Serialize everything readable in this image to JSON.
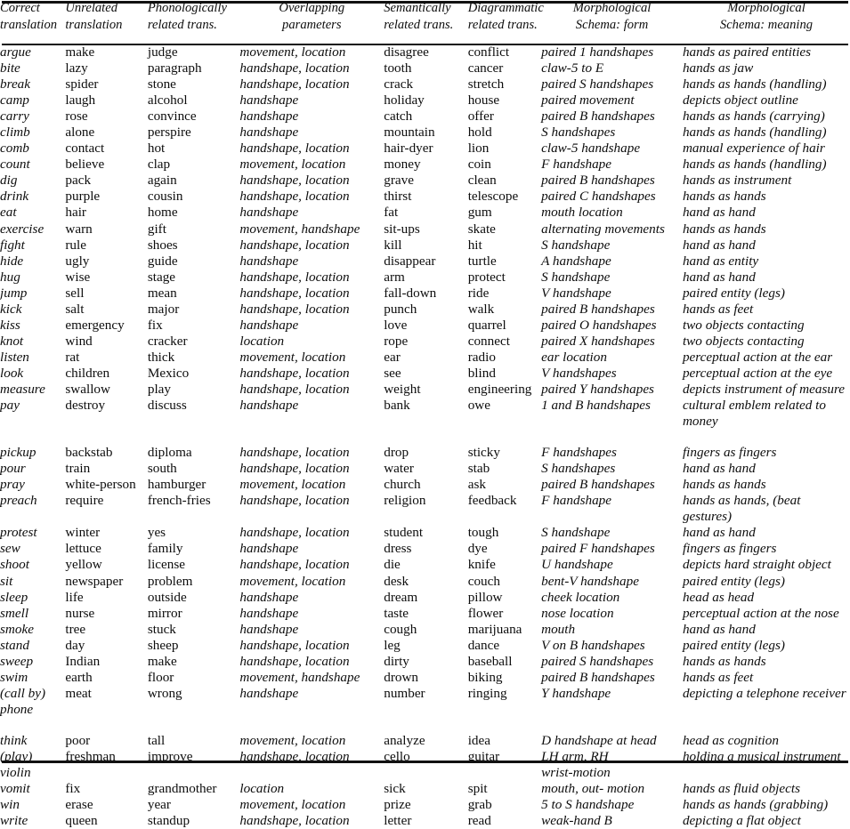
{
  "table": {
    "caption": "",
    "columns": [
      {
        "id": "correct",
        "label": "Correct\ntranslation"
      },
      {
        "id": "unrelated",
        "label": "Unrelated\ntranslation"
      },
      {
        "id": "phono",
        "label": "Phonologically\nrelated trans."
      },
      {
        "id": "overlap",
        "label": "Overlapping\nparameters"
      },
      {
        "id": "semantic",
        "label": "Semantically\nrelated trans."
      },
      {
        "id": "diagram",
        "label": "Diagrammatic\nrelated trans."
      },
      {
        "id": "form",
        "label": "Morphological\nSchema: form"
      },
      {
        "id": "meaning",
        "label": "Morphological\nSchema: meaning"
      }
    ],
    "groups": [
      {
        "rows": [
          [
            "argue",
            "make",
            "judge",
            "movement, location",
            "disagree",
            "conflict",
            "paired 1 handshapes",
            "hands as paired entities"
          ],
          [
            "bite",
            "lazy",
            "paragraph",
            "handshape, location",
            "tooth",
            "cancer",
            "claw-5 to E",
            "hands as jaw"
          ],
          [
            "break",
            "spider",
            "stone",
            "handshape, location",
            "crack",
            "stretch",
            "paired S handshapes",
            "hands as hands (handling)"
          ],
          [
            "camp",
            "laugh",
            "alcohol",
            "handshape",
            "holiday",
            "house",
            "paired movement",
            "depicts object outline"
          ],
          [
            "carry",
            "rose",
            "convince",
            "handshape",
            "catch",
            "offer",
            "paired B handshapes",
            "hands as hands (carrying)"
          ],
          [
            "climb",
            "alone",
            "perspire",
            "handshape",
            "mountain",
            "hold",
            "S handshapes",
            "hands as hands (handling)"
          ],
          [
            "comb",
            "contact",
            "hot",
            "handshape, location",
            "hair-dyer",
            "lion",
            "claw-5 handshape",
            "manual experience of hair"
          ],
          [
            "count",
            "believe",
            "clap",
            "movement, location",
            "money",
            "coin",
            "F handshape",
            "hands as hands (handling)"
          ],
          [
            "dig",
            "pack",
            "again",
            "handshape, location",
            "grave",
            "clean",
            "paired B handshapes",
            "hands as instrument"
          ],
          [
            "drink",
            "purple",
            "cousin",
            "handshape, location",
            "thirst",
            "telescope",
            "paired C handshapes",
            "hands as hands"
          ],
          [
            "eat",
            "hair",
            "home",
            "handshape",
            "fat",
            "gum",
            "mouth location",
            "hand as hand"
          ],
          [
            "exercise",
            "warn",
            "gift",
            "movement, handshape",
            "sit-ups",
            "skate",
            "alternating movements",
            "hands as hands"
          ],
          [
            "fight",
            "rule",
            "shoes",
            "handshape, location",
            "kill",
            "hit",
            "S handshape",
            "hand as hand"
          ],
          [
            "hide",
            "ugly",
            "guide",
            "handshape",
            "disappear",
            "turtle",
            "A handshape",
            "hand as entity"
          ],
          [
            "hug",
            "wise",
            "stage",
            "handshape, location",
            "arm",
            "protect",
            "S handshape",
            "hand as hand"
          ],
          [
            "jump",
            "sell",
            "mean",
            "handshape, location",
            "fall-down",
            "ride",
            "V handshape",
            "paired entity (legs)"
          ],
          [
            "kick",
            "salt",
            "major",
            "handshape, location",
            "punch",
            "walk",
            "paired B handshapes",
            "hands as feet"
          ],
          [
            "kiss",
            "emergency",
            "fix",
            "handshape",
            "love",
            "quarrel",
            "paired O handshapes",
            "two objects contacting"
          ],
          [
            "knot",
            "wind",
            "cracker",
            "location",
            "rope",
            "connect",
            "paired X handshapes",
            "two objects contacting"
          ],
          [
            "listen",
            "rat",
            "thick",
            "movement, location",
            "ear",
            "radio",
            "ear location",
            "perceptual action at the ear"
          ],
          [
            "look",
            "children",
            "Mexico",
            "handshape, location",
            "see",
            "blind",
            "V handshapes",
            "perceptual action at the eye"
          ],
          [
            "measure",
            "swallow",
            "play",
            "handshape, location",
            "weight",
            "engineering",
            "paired Y handshapes",
            "depicts instrument of measure"
          ],
          [
            "pay",
            "destroy",
            "discuss",
            "handshape",
            "bank",
            "owe",
            "1 and B handshapes",
            "cultural emblem related to\nmoney"
          ]
        ]
      },
      {
        "rows": [
          [
            "pickup",
            "backstab",
            "diploma",
            "handshape, location",
            "drop",
            "sticky",
            "F handshapes",
            "fingers as fingers"
          ],
          [
            "pour",
            "train",
            "south",
            "handshape, location",
            "water",
            "stab",
            "S handshapes",
            "hand as hand"
          ],
          [
            "pray",
            "white-person",
            "hamburger",
            "movement, location",
            "church",
            "ask",
            "paired B handshapes",
            "hands as hands"
          ],
          [
            "preach",
            "require",
            "french-fries",
            "handshape, location",
            "religion",
            "feedback",
            "F handshape",
            "hands as hands, (beat gestures)"
          ],
          [
            "protest",
            "winter",
            "yes",
            "handshape, location",
            "student",
            "tough",
            "S handshape",
            "hand as hand"
          ],
          [
            "sew",
            "lettuce",
            "family",
            "handshape",
            "dress",
            "dye",
            "paired F handshapes",
            "fingers as fingers"
          ],
          [
            "shoot",
            "yellow",
            "license",
            "handshape, location",
            "die",
            "knife",
            "U handshape",
            "depicts hard straight object"
          ],
          [
            "sit",
            "newspaper",
            "problem",
            "movement, location",
            "desk",
            "couch",
            "bent-V handshape",
            "paired entity (legs)"
          ],
          [
            "sleep",
            "life",
            "outside",
            "handshape",
            "dream",
            "pillow",
            "cheek location",
            "head as head"
          ],
          [
            "smell",
            "nurse",
            "mirror",
            "handshape",
            "taste",
            "flower",
            "nose location",
            "perceptual action at the nose"
          ],
          [
            "smoke",
            "tree",
            "stuck",
            "handshape",
            "cough",
            "marijuana",
            "mouth",
            "hand as hand"
          ],
          [
            "stand",
            "day",
            "sheep",
            "handshape, location",
            "leg",
            "dance",
            "V on B handshapes",
            "paired entity (legs)"
          ],
          [
            "sweep",
            "Indian",
            "make",
            "handshape, location",
            "dirty",
            "baseball",
            "paired S handshapes",
            "hands as hands"
          ],
          [
            "swim",
            "earth",
            "floor",
            "movement, handshape",
            "drown",
            "biking",
            "paired B handshapes",
            "hands as feet"
          ],
          [
            "(call by)\n    phone",
            "meat",
            "wrong",
            "handshape",
            "number",
            "ringing",
            "Y handshape",
            "depicting a telephone receiver"
          ]
        ]
      },
      {
        "rows": [
          [
            "think",
            "poor",
            "tall",
            "movement, location",
            "analyze",
            "idea",
            "D handshape at head",
            "head as cognition"
          ],
          [
            "(play)\n    violin",
            "freshman",
            "improve",
            "handshape, location",
            "cello",
            "guitar",
            "LH arm, RH\nwrist-motion",
            "holding a musical instrument"
          ],
          [
            "vomit",
            "fix",
            "grandmother",
            "location",
            "sick",
            "spit",
            "mouth, out- motion",
            "hands as fluid objects"
          ],
          [
            "win",
            "erase",
            "year",
            "movement, location",
            "prize",
            "grab",
            "5 to S handshape",
            "hands as hands (grabbing)"
          ],
          [
            "write",
            "queen",
            "standup",
            "handshape, location",
            "letter",
            "read",
            "weak-hand B",
            "depicting a flat object"
          ]
        ]
      }
    ]
  },
  "style": {
    "rule_color": "#111111",
    "text_color": "#0d0d0d",
    "background": "#ffffff"
  }
}
